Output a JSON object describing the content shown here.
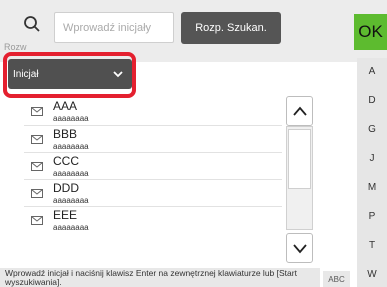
{
  "header": {
    "search_placeholder": "Wprowadź inicjały",
    "search_button": "Rozp. Szukan.",
    "ok_button": "OK",
    "faded_label": "Rozw"
  },
  "filter": {
    "selected": "Inicjał"
  },
  "entries": [
    {
      "name": "AAA",
      "detail": "aaaaaaaa"
    },
    {
      "name": "BBB",
      "detail": "aaaaaaaa"
    },
    {
      "name": "CCC",
      "detail": "aaaaaaaa"
    },
    {
      "name": "DDD",
      "detail": "aaaaaaaa"
    },
    {
      "name": "EEE",
      "detail": "aaaaaaaa"
    }
  ],
  "index_letters": [
    "A",
    "D",
    "G",
    "J",
    "M",
    "P",
    "T",
    "W"
  ],
  "footer": {
    "hint": "Wprowadź inicjał i naciśnij klawisz Enter na zewnętrznej klawiaturze lub [Start wyszukiwania].",
    "abc_button": "ABC"
  },
  "colors": {
    "highlight": "#e4202f",
    "ok": "#5dbb2f",
    "dark_button": "#555555"
  },
  "icons": [
    "search-icon",
    "chevron-down-icon",
    "mail-icon",
    "arrow-up-icon",
    "arrow-down-icon"
  ]
}
